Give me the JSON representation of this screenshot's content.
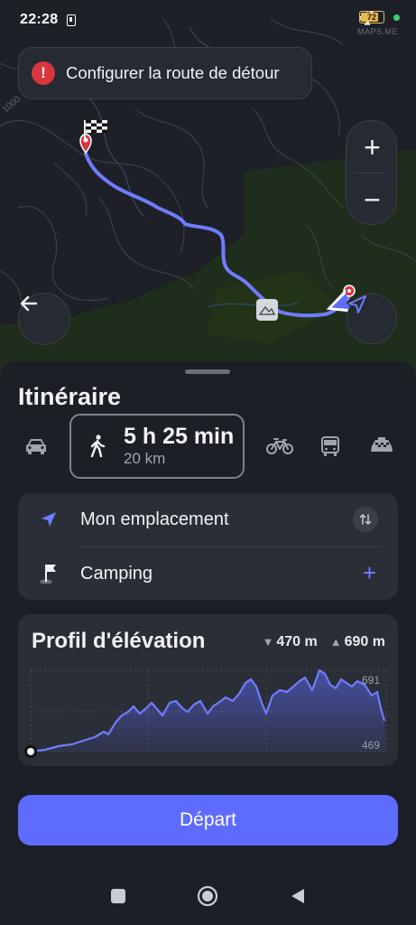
{
  "status_bar": {
    "time": "22:28",
    "battery": "72",
    "watermark": "MAPS.ME"
  },
  "map": {
    "contour_label": "1000"
  },
  "banner": {
    "text": "Configurer la route de détour"
  },
  "zoom": {
    "plus": "+",
    "minus": "−"
  },
  "sheet": {
    "title": "Itinéraire",
    "modes": {
      "active": "walk",
      "walk": {
        "duration": "5 h 25 min",
        "distance": "20 km"
      }
    },
    "waypoints": {
      "from": "Mon emplacement",
      "to": "Camping"
    },
    "elevation": {
      "title": "Profil d'élévation",
      "descent": "470 m",
      "ascent": "690 m",
      "max_label": "691",
      "min_label": "469"
    },
    "depart_label": "Départ"
  },
  "colors": {
    "accent": "#5e6bff",
    "route": "#6f7cff",
    "alert": "#d9363e"
  }
}
